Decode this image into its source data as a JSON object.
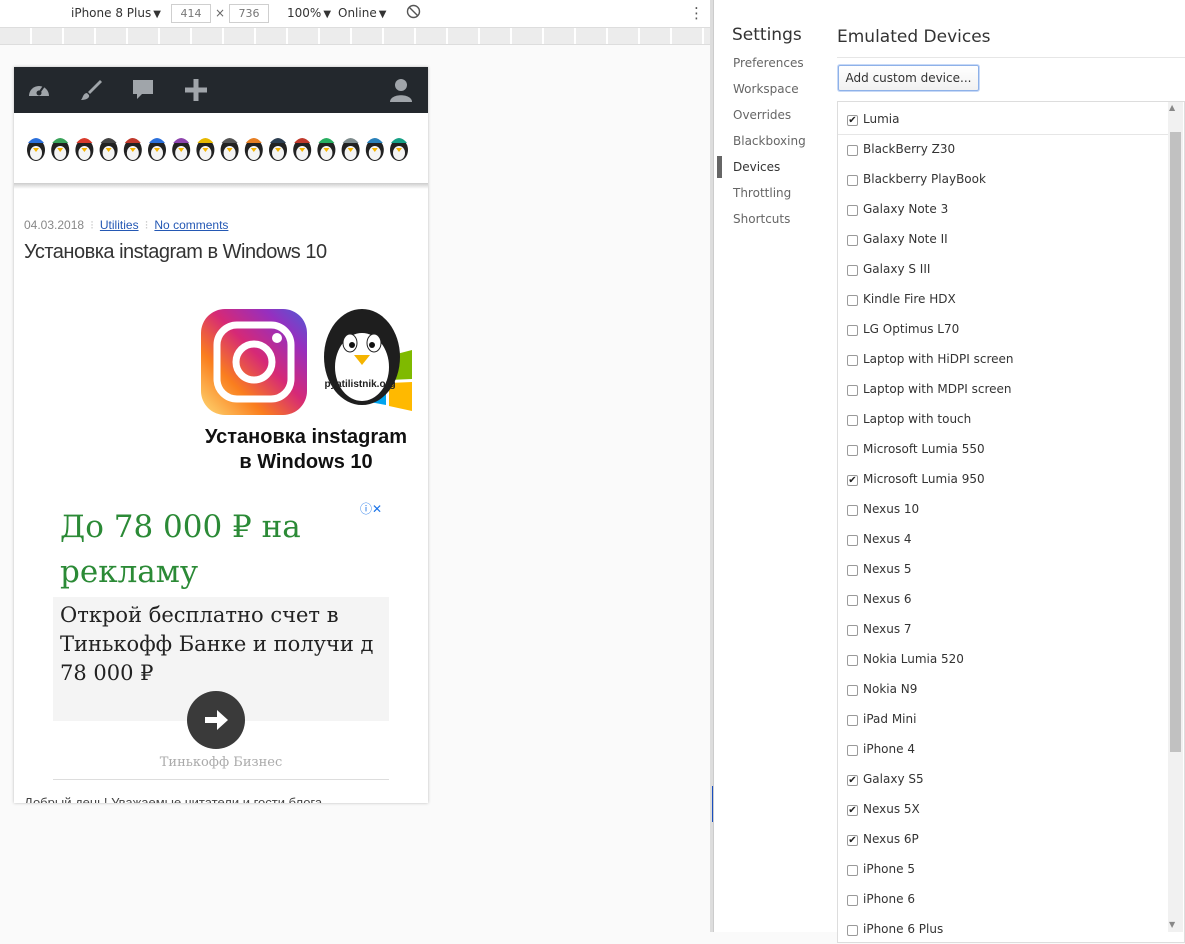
{
  "device_toolbar": {
    "device": "iPhone 8 Plus",
    "width": "414",
    "times": "×",
    "height": "736",
    "zoom": "100%",
    "network": "Online",
    "caret": "▼",
    "more": "⋮"
  },
  "page": {
    "post_date": "04.03.2018",
    "category": "Utilities",
    "comments": "No comments",
    "title": "Установка instagram в Windows 10",
    "featured_caption_line1": "Установка instagram",
    "featured_caption_line2": "в Windows 10",
    "featured_logo_text": "pyatilistnik.org",
    "ad": {
      "headline": "До 78 000 ₽ на рекламу",
      "body_line1": "Открой бесплатно счет в",
      "body_line2": "Тинькофф Банке и получи д",
      "body_line3": "78 000 ₽",
      "brand": "Тинькофф Бизнес",
      "close": "ⓘ✕"
    },
    "bottom_text": "Добрый день! Уважаемые читатели и гости блога"
  },
  "settings": {
    "title": "Settings",
    "nav": [
      "Preferences",
      "Workspace",
      "Overrides",
      "Blackboxing",
      "Devices",
      "Throttling",
      "Shortcuts"
    ],
    "active_nav": "Devices",
    "panel_title": "Emulated Devices",
    "add_button": "Add custom device...",
    "devices": [
      {
        "name": "Lumia",
        "checked": true
      },
      {
        "name": "BlackBerry Z30",
        "checked": false
      },
      {
        "name": "Blackberry PlayBook",
        "checked": false
      },
      {
        "name": "Galaxy Note 3",
        "checked": false
      },
      {
        "name": "Galaxy Note II",
        "checked": false
      },
      {
        "name": "Galaxy S III",
        "checked": false
      },
      {
        "name": "Kindle Fire HDX",
        "checked": false
      },
      {
        "name": "LG Optimus L70",
        "checked": false
      },
      {
        "name": "Laptop with HiDPI screen",
        "checked": false
      },
      {
        "name": "Laptop with MDPI screen",
        "checked": false
      },
      {
        "name": "Laptop with touch",
        "checked": false
      },
      {
        "name": "Microsoft Lumia 550",
        "checked": false
      },
      {
        "name": "Microsoft Lumia 950",
        "checked": true
      },
      {
        "name": "Nexus 10",
        "checked": false
      },
      {
        "name": "Nexus 4",
        "checked": false
      },
      {
        "name": "Nexus 5",
        "checked": false
      },
      {
        "name": "Nexus 6",
        "checked": false
      },
      {
        "name": "Nexus 7",
        "checked": false
      },
      {
        "name": "Nokia Lumia 520",
        "checked": false
      },
      {
        "name": "Nokia N9",
        "checked": false
      },
      {
        "name": "iPad Mini",
        "checked": false
      },
      {
        "name": "iPhone 4",
        "checked": false
      },
      {
        "name": "Galaxy S5",
        "checked": true
      },
      {
        "name": "Nexus 5X",
        "checked": true
      },
      {
        "name": "Nexus 6P",
        "checked": true
      },
      {
        "name": "iPhone 5",
        "checked": false
      },
      {
        "name": "iPhone 6",
        "checked": false
      },
      {
        "name": "iPhone 6 Plus",
        "checked": false
      }
    ]
  },
  "colors": {
    "wp_admin_bar": "#23282d",
    "ad_headline": "#2b8a36",
    "link": "#2458b4",
    "instagram_gradient": [
      "#feda75",
      "#fa7e1e",
      "#d62976",
      "#962fbf",
      "#4f5bd5"
    ]
  }
}
